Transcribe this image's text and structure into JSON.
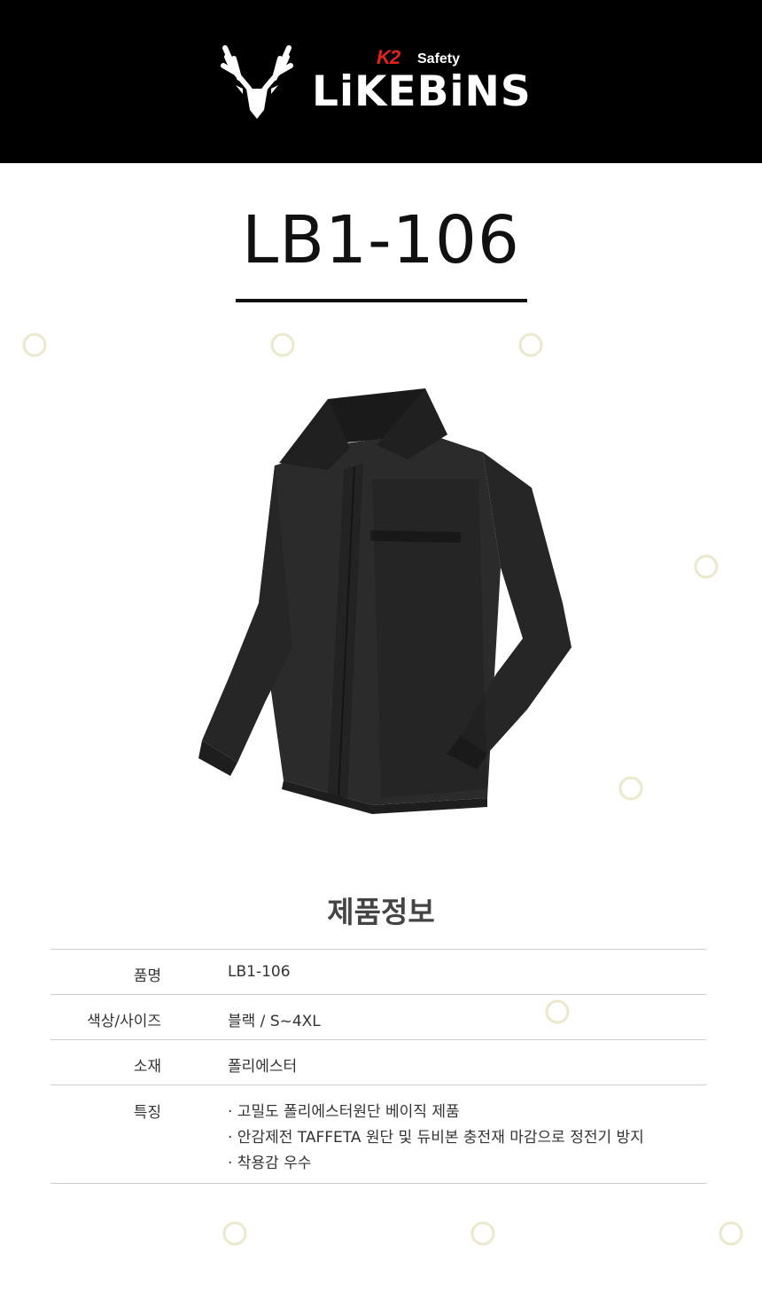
{
  "header": {
    "k2_logo": "K2",
    "safety_label": "Safety",
    "brand_name": "LiKEBiNS",
    "logo_icon": "deer-antler-icon"
  },
  "product": {
    "model": "LB1-106",
    "image_icon": "black-jacket-image"
  },
  "info": {
    "section_title": "제품정보",
    "rows": [
      {
        "label": "품명",
        "value": "LB1-106"
      },
      {
        "label": "색상/사이즈",
        "value": "블랙 / S~4XL"
      },
      {
        "label": "소재",
        "value": "폴리에스터"
      }
    ],
    "features_label": "특징",
    "features": [
      "· 고밀도 폴리에스터원단 베이직 제품",
      "· 안감제전 TAFFETA 원단 및 듀비본 충전재 마감으로 정전기 방지",
      "· 착용감 우수"
    ]
  },
  "colors": {
    "header_bg": "#000000",
    "k2_red": "#e2231a",
    "text": "#333333",
    "rule": "#111111"
  }
}
